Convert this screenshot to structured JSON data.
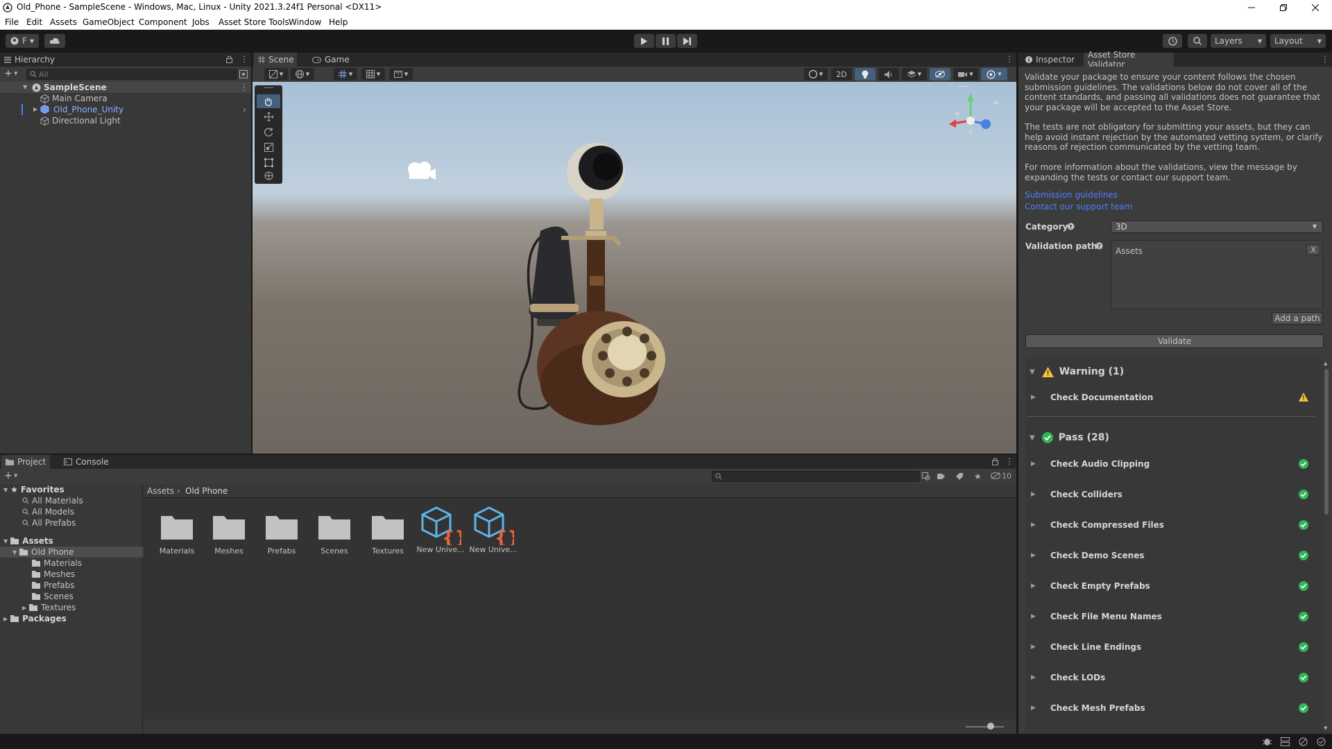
{
  "window": {
    "title": "Old_Phone - SampleScene - Windows, Mac, Linux - Unity 2021.3.24f1 Personal <DX11>"
  },
  "menu": [
    "File",
    "Edit",
    "Assets",
    "GameObject",
    "Component",
    "Jobs",
    "Asset Store Tools",
    "Window",
    "Help"
  ],
  "toolbar": {
    "account_label": "F",
    "layers_label": "Layers",
    "layout_label": "Layout"
  },
  "hierarchy": {
    "tab_label": "Hierarchy",
    "search_placeholder": "All",
    "scene_name": "SampleScene",
    "items": [
      "Main Camera",
      "Old_Phone_Unity",
      "Directional Light"
    ]
  },
  "scene": {
    "tabs": [
      "Scene",
      "Game"
    ],
    "mode_2d": "2D"
  },
  "project": {
    "tabs": [
      "Project",
      "Console"
    ],
    "hidden_count": "10",
    "favorites_label": "Favorites",
    "favorites": [
      "All Materials",
      "All Models",
      "All Prefabs"
    ],
    "assets_label": "Assets",
    "tree": [
      "Old Phone",
      "Materials",
      "Meshes",
      "Prefabs",
      "Scenes",
      "Textures"
    ],
    "packages_label": "Packages",
    "breadcrumb": [
      "Assets",
      "Old Phone"
    ],
    "assets": [
      "Materials",
      "Meshes",
      "Prefabs",
      "Scenes",
      "Textures",
      "New Unive...",
      "New Unive..."
    ]
  },
  "inspector": {
    "tabs": [
      "Inspector",
      "Asset Store Validator"
    ],
    "intro_1": "Validate your package to ensure your content follows the chosen submission guidelines. The validations below do not cover all of the content standards, and passing all validations does not guarantee that your package will be accepted to the Asset Store.",
    "intro_2": "The tests are not obligatory for submitting your assets, but they can help avoid instant rejection by the automated vetting system, or clarify reasons of rejection communicated by the vetting team.",
    "intro_3": "For more information about the validations, view the message by expanding the tests or contact our support team.",
    "link_guidelines": "Submission guidelines",
    "link_support": "Contact our support team",
    "category_label": "Category",
    "category_value": "3D",
    "paths_label": "Validation paths",
    "path_item": "Assets",
    "remove_label": "X",
    "add_path_label": "Add a path",
    "validate_label": "Validate",
    "warning_header": "Warning (1)",
    "warnings": [
      "Check Documentation"
    ],
    "pass_header": "Pass (28)",
    "passes": [
      "Check Audio Clipping",
      "Check Colliders",
      "Check Compressed Files",
      "Check Demo Scenes",
      "Check Empty Prefabs",
      "Check File Menu Names",
      "Check Line Endings",
      "Check LODs",
      "Check Mesh Prefabs"
    ]
  },
  "colors": {
    "accent_link": "#4c7eff",
    "pass_green": "#2fb55a",
    "warning_yellow": "#f5c23a",
    "selected_blue": "#8ab4ff"
  }
}
